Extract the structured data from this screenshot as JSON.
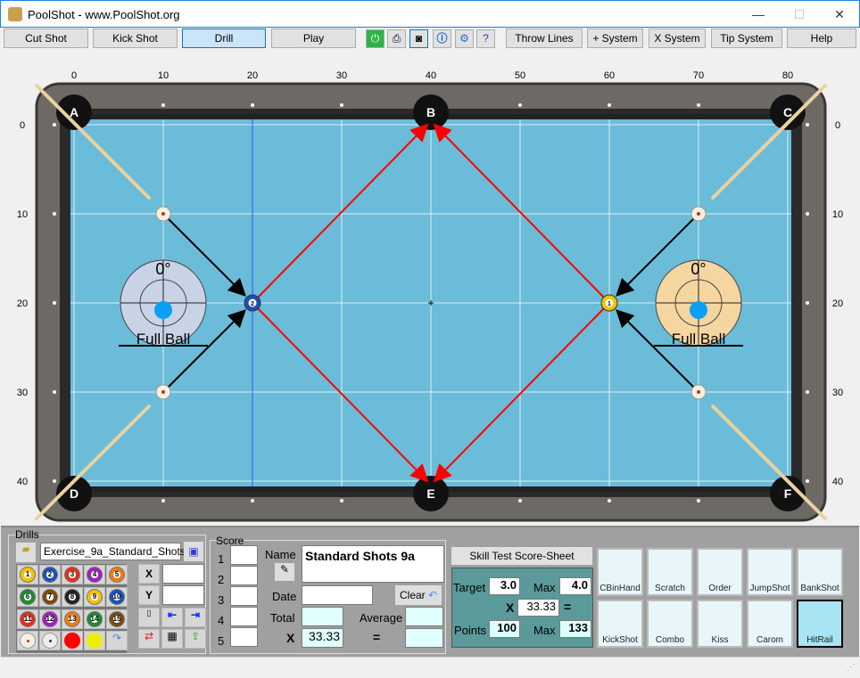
{
  "window": {
    "title": "PoolShot - www.PoolShot.org",
    "minimize": "—",
    "maximize": "☐",
    "close": "✕"
  },
  "toolbar": {
    "buttons": [
      "Cut Shot",
      "Kick Shot",
      "Drill",
      "Play"
    ],
    "selected": "Drill",
    "icons": [
      "power-icon",
      "printer-icon",
      "camera-icon",
      "info-icon",
      "gear-icon",
      "help-document-icon"
    ],
    "right_buttons": [
      "Throw Lines",
      "+ System",
      "X System",
      "Tip System",
      "Help"
    ]
  },
  "table": {
    "x_ticks": [
      "0",
      "10",
      "20",
      "30",
      "40",
      "50",
      "60",
      "70",
      "80"
    ],
    "y_ticks": [
      "0",
      "10",
      "20",
      "30",
      "40"
    ],
    "pockets": [
      {
        "label": "A",
        "x": 0,
        "y": 0
      },
      {
        "label": "B",
        "x": 40,
        "y": 0
      },
      {
        "label": "C",
        "x": 80,
        "y": 0
      },
      {
        "label": "D",
        "x": 0,
        "y": 40
      },
      {
        "label": "E",
        "x": 40,
        "y": 40
      },
      {
        "label": "F",
        "x": 80,
        "y": 40
      }
    ],
    "cue_balls": [
      {
        "x": 10,
        "y": 10
      },
      {
        "x": 10,
        "y": 30
      },
      {
        "x": 70,
        "y": 10
      },
      {
        "x": 70,
        "y": 30
      }
    ],
    "object_balls": [
      {
        "number": "2",
        "x": 20,
        "y": 20,
        "color": "#1e4fb8"
      },
      {
        "number": "1",
        "x": 60,
        "y": 20,
        "color": "#f2c200"
      }
    ],
    "aim_indicators": [
      {
        "angle": "0°",
        "label": "Full Ball",
        "x": 10,
        "y": 20
      },
      {
        "angle": "0°",
        "label": "Full Ball",
        "x": 70,
        "y": 20
      }
    ],
    "felt_color": "#6bbcd8",
    "path_color": "#ff0000"
  },
  "drills": {
    "title": "Drills",
    "file": "Exercise_9a_Standard_Shots",
    "balls": [
      "1",
      "2",
      "3",
      "4",
      "5",
      "6",
      "7",
      "8",
      "9",
      "10",
      "11",
      "12",
      "13",
      "14",
      "15"
    ],
    "ball_colors": [
      "#f2c200",
      "#1e4fb8",
      "#e03020",
      "#a020c0",
      "#f07a10",
      "#1a8a30",
      "#7a4a10",
      "#222222",
      "#f2c200",
      "#1e4fb8",
      "#e03020",
      "#a020c0",
      "#f07a10",
      "#1a8a30",
      "#7a4a10"
    ],
    "x_label": "X",
    "y_label": "Y",
    "x_value": "",
    "y_value": ""
  },
  "score": {
    "title": "Score",
    "rows": [
      "1",
      "2",
      "3",
      "4",
      "5"
    ],
    "name_label": "Name",
    "name_value": "Standard Shots 9a",
    "date_label": "Date",
    "clear_label": "Clear",
    "total_label": "Total",
    "average_label": "Average",
    "x_label": "X",
    "multiplier": "33.33",
    "equals": "="
  },
  "skill": {
    "title": "Skill Test Score-Sheet",
    "target_label": "Target",
    "target": "3.0",
    "max_label": "Max",
    "max": "4.0",
    "x": "X",
    "multiplier": "33.33",
    "equals": "=",
    "points_label": "Points",
    "points": "100",
    "points_max": "133"
  },
  "drill_types": [
    "CBinHand",
    "Scratch",
    "Order",
    "JumpShot",
    "BankShot",
    "KickShot",
    "Combo",
    "Kiss",
    "Carom",
    "HitRail"
  ],
  "active_drill_type": "HitRail"
}
